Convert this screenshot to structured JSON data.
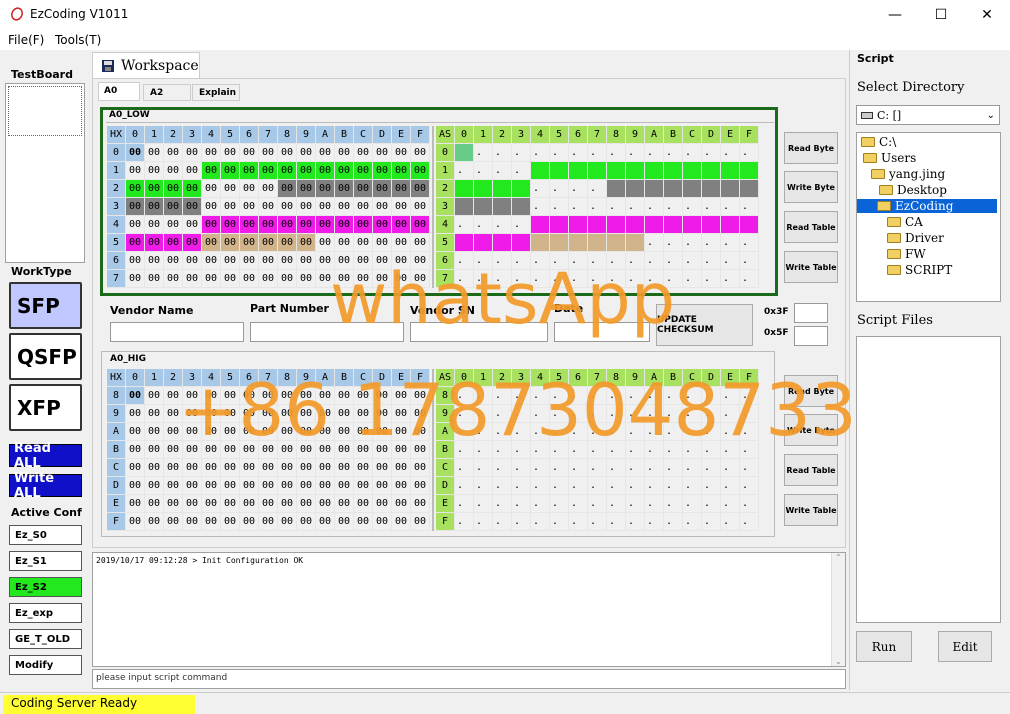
{
  "window": {
    "title": "EzCoding V1011",
    "minimize": "—",
    "maximize": "☐",
    "close": "✕"
  },
  "menu": {
    "file": "File(F)",
    "tools": "Tools(T)"
  },
  "left": {
    "testboard_title": "TestBoard",
    "worktype_title": "WorkType",
    "worktypes": [
      "SFP",
      "QSFP",
      "XFP"
    ],
    "read_all": "Read ALL",
    "write_all": "Write ALL",
    "active_conf_title": "Active Conf",
    "confs": [
      "Ez_S0",
      "Ez_S1",
      "Ez_S2",
      "Ez_exp",
      "GE_T_OLD",
      "Modify"
    ]
  },
  "workspace": {
    "tab": "Workspace",
    "subtabs": [
      "A0",
      "A2",
      "Explain"
    ],
    "low_title": "A0_LOW",
    "hig_title": "A0_HIG",
    "hx": "HX",
    "as": "AS",
    "cols": [
      "0",
      "1",
      "2",
      "3",
      "4",
      "5",
      "6",
      "7",
      "8",
      "9",
      "A",
      "B",
      "C",
      "D",
      "E",
      "F"
    ],
    "low_rows": [
      "0",
      "1",
      "2",
      "3",
      "4",
      "5",
      "6",
      "7"
    ],
    "hig_rows": [
      "8",
      "9",
      "A",
      "B",
      "C",
      "D",
      "E",
      "F"
    ],
    "cell": "00",
    "dot": ".",
    "buttons": [
      "Read Byte",
      "Write Byte",
      "Read Table",
      "Write Table"
    ],
    "vendor_name": "Vendor Name",
    "part_number": "Part Number",
    "vendor_sn": "Vendor SN",
    "date": "Date",
    "update_checksum": "UPDATE CHECKSUM",
    "cs1": "0x3F",
    "cs2": "0x5F",
    "colors": {
      "green": "#22e81e",
      "gray": "#808080",
      "magenta": "#ef1be8",
      "tan": "#d2b48c",
      "selected": "#66cc88"
    }
  },
  "log": {
    "line": "2019/10/17 09:12:28 > Init Configuration OK",
    "placeholder": "please input script command"
  },
  "script": {
    "title": "Script",
    "select_dir": "Select Directory",
    "drive": "C: []",
    "tree": [
      "C:\\",
      "Users",
      "yang.jing",
      "Desktop",
      "EzCoding",
      "CA",
      "Driver",
      "FW",
      "SCRIPT"
    ],
    "files_title": "Script Files",
    "run": "Run",
    "edit": "Edit"
  },
  "status": {
    "text": "Coding Server Ready"
  },
  "watermark": {
    "line1": "whatsApp",
    "line2": "+86 17873048733"
  }
}
